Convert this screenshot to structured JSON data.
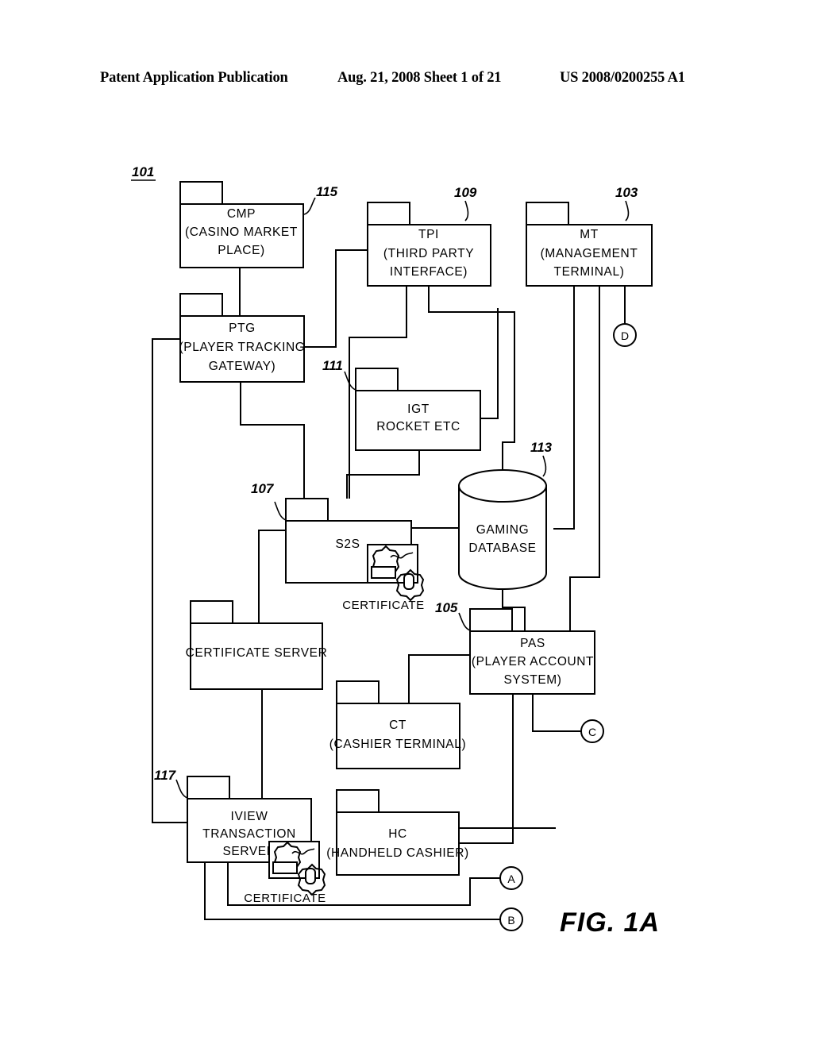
{
  "header": {
    "publication": "Patent Application Publication",
    "date_sheet": "Aug. 21, 2008  Sheet 1 of 21",
    "patent_number": "US 2008/0200255 A1"
  },
  "figure": {
    "label": "FIG.  1A",
    "diagram_ref": "101"
  },
  "nodes": [
    {
      "id": "cmp",
      "ref": "115",
      "lines": [
        "CMP",
        "(CASINO MARKET",
        "PLACE)"
      ],
      "shape": "package"
    },
    {
      "id": "tpi",
      "ref": "109",
      "lines": [
        "TPI",
        "(THIRD PARTY",
        "INTERFACE)"
      ],
      "shape": "package"
    },
    {
      "id": "mt",
      "ref": "103",
      "lines": [
        "MT",
        "(MANAGEMENT",
        "TERMINAL)"
      ],
      "shape": "package"
    },
    {
      "id": "ptg",
      "ref": "",
      "lines": [
        "PTG",
        "(PLAYER TRACKING",
        "GATEWAY)"
      ],
      "shape": "package"
    },
    {
      "id": "igt",
      "ref": "111",
      "lines": [
        "IGT",
        "ROCKET ETC"
      ],
      "shape": "package"
    },
    {
      "id": "s2s",
      "ref": "107",
      "lines": [
        "S2S"
      ],
      "shape": "package",
      "badge": "CERTIFICATE"
    },
    {
      "id": "gaming_database",
      "ref": "113",
      "lines": [
        "GAMING",
        "DATABASE"
      ],
      "shape": "cylinder"
    },
    {
      "id": "certificate_server",
      "ref": "",
      "lines": [
        "CERTIFICATE SERVER"
      ],
      "shape": "package"
    },
    {
      "id": "pas",
      "ref": "105",
      "lines": [
        "PAS",
        "(PLAYER ACCOUNT",
        "SYSTEM)"
      ],
      "shape": "package"
    },
    {
      "id": "ct",
      "ref": "",
      "lines": [
        "CT",
        "(CASHIER TERMINAL)"
      ],
      "shape": "package"
    },
    {
      "id": "iview",
      "ref": "117",
      "lines": [
        "IVIEW",
        "TRANSACTION",
        "SERVER"
      ],
      "shape": "package",
      "badge": "CERTIFICATE"
    },
    {
      "id": "hc",
      "ref": "",
      "lines": [
        "HC",
        "(HANDHELD CASHIER)"
      ],
      "shape": "package"
    }
  ],
  "offpage_connectors": [
    {
      "id": "conn_d",
      "label": "D"
    },
    {
      "id": "conn_c",
      "label": "C"
    },
    {
      "id": "conn_a",
      "label": "A"
    },
    {
      "id": "conn_b",
      "label": "B"
    }
  ],
  "badges": {
    "certificate": "CERTIFICATE"
  },
  "colors": {
    "ink": "#000000",
    "paper": "#ffffff"
  }
}
